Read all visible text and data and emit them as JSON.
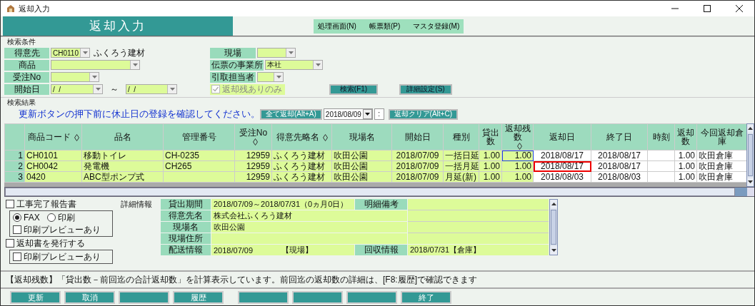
{
  "window": {
    "title": "返却入力"
  },
  "header": {
    "title": "返却入力",
    "menus": [
      "処理画面(N)",
      "帳票類(P)",
      "マスタ登録(M)"
    ]
  },
  "search": {
    "heading": "検索条件",
    "customer": {
      "label": "得意先",
      "code": "CH0110",
      "name": "ふくろう建材"
    },
    "product": {
      "label": "商品"
    },
    "order_no": {
      "label": "受注No"
    },
    "start_date": {
      "label": "開始日",
      "from": "/  /",
      "separator": "～",
      "to": "/  /"
    },
    "site": {
      "label": "現場"
    },
    "office": {
      "label": "伝票の事業所",
      "value": "本社"
    },
    "pickup_staff": {
      "label": "引取担当者"
    },
    "remaining_only": {
      "label": "返却残ありのみ",
      "checked": true,
      "disabled": true
    },
    "buttons": [
      "検索(F1)",
      "詳細設定(S)"
    ]
  },
  "results": {
    "heading": "検索結果",
    "notice": "更新ボタンの押下前に休止日の登録を確認してください。",
    "all_return_button": "全て返却(Alt+A)",
    "date": "2018/08/09",
    "time": ":",
    "clear_button": "返却クリア(Alt+C)"
  },
  "table": {
    "columns": [
      {
        "label": "商品コード",
        "sortable": true,
        "editable": false
      },
      {
        "label": "品名",
        "sortable": false,
        "editable": false
      },
      {
        "label": "管理番号",
        "sortable": false,
        "editable": false
      },
      {
        "label": "受注No",
        "sortable": true,
        "editable": false
      },
      {
        "label": "得意先略名",
        "sortable": true,
        "editable": false
      },
      {
        "label": "現場名",
        "sortable": false,
        "editable": false
      },
      {
        "label": "開始日",
        "sortable": false,
        "editable": false
      },
      {
        "label": "種別",
        "sortable": false,
        "editable": false
      },
      {
        "label": "貸出数",
        "sortable": false,
        "editable": false
      },
      {
        "label": "返却残数",
        "sortable": true,
        "editable": false
      },
      {
        "label": "返却日",
        "sortable": false,
        "editable": true
      },
      {
        "label": "終了日",
        "sortable": false,
        "editable": true
      },
      {
        "label": "時刻",
        "sortable": false,
        "editable": true
      },
      {
        "label": "返却数",
        "sortable": false,
        "editable": true
      },
      {
        "label": "今回返却倉庫",
        "sortable": false,
        "editable": true
      }
    ],
    "rows": [
      {
        "number": "1",
        "cursor": true,
        "date_error": false,
        "cells": [
          "CH0101",
          "移動トイレ",
          "CH-0235",
          "12959",
          "ふくろう建材",
          "吹田公園",
          "2018/07/09",
          "一括日延",
          "1.00",
          "1.00",
          "2018/08/17",
          "2018/08/17",
          "",
          "1.00",
          "吹田倉庫"
        ]
      },
      {
        "number": "2",
        "cursor": false,
        "date_error": true,
        "cells": [
          "CH0042",
          "発電機",
          "CH265",
          "12959",
          "ふくろう建材",
          "吹田公園",
          "2018/07/09",
          "一括月延",
          "1.00",
          "1.00",
          "2018/08/17",
          "2018/08/17",
          "",
          "1.00",
          "吹田倉庫"
        ]
      },
      {
        "number": "3",
        "cursor": false,
        "date_error": false,
        "cells": [
          "0420",
          "ABC型ポンプ式",
          "",
          "12959",
          "ふくろう建材",
          "吹田公園",
          "2018/07/09",
          "月延(新)",
          "1.00",
          "1.00",
          "2018/08/03",
          "2018/08/03",
          "",
          "1.00",
          "吹田倉庫"
        ]
      }
    ]
  },
  "report": {
    "completion_report": {
      "label": "工事完了報告書",
      "checked": false
    },
    "send_methods": [
      {
        "label": "FAX",
        "selected": true
      },
      {
        "label": "印刷",
        "selected": false
      }
    ],
    "completion_preview": {
      "label": "印刷プレビューあり",
      "checked": false
    },
    "issue_return": {
      "label": "返却書を発行する",
      "checked": false
    },
    "return_preview": {
      "label": "印刷プレビューあり",
      "checked": false
    }
  },
  "details": {
    "heading": "詳細情報",
    "period": {
      "label": "貸出期間",
      "value": "2018/07/09～2018/07/31（0ヵ月0日）"
    },
    "remarks": {
      "label": "明細備考"
    },
    "customer_name": {
      "label": "得意先名",
      "value": "株式会社ふくろう建材"
    },
    "site_name": {
      "label": "現場名",
      "value": "吹田公園"
    },
    "site_address": {
      "label": "現場住所"
    },
    "delivery": {
      "label": "配送情報",
      "date": "2018/07/09",
      "place": "【現場】"
    },
    "collection": {
      "label": "回収情報",
      "value": "2018/07/31【倉庫】"
    }
  },
  "status_message": "【返却残数】「貸出数－前回迄の合計返却数」を計算表示しています。前回迄の返却数の詳細は、[F8:履歴]で確認できます",
  "function_keys": [
    [
      {
        "kind": "key",
        "label": "更新"
      },
      {
        "kind": "key",
        "label": "取消"
      },
      {
        "kind": "blank"
      },
      {
        "kind": "key",
        "label": "履歴"
      }
    ],
    [
      {
        "kind": "blank"
      },
      {
        "kind": "blank"
      },
      {
        "kind": "blank"
      },
      {
        "kind": "key",
        "label": "終了"
      }
    ]
  ]
}
